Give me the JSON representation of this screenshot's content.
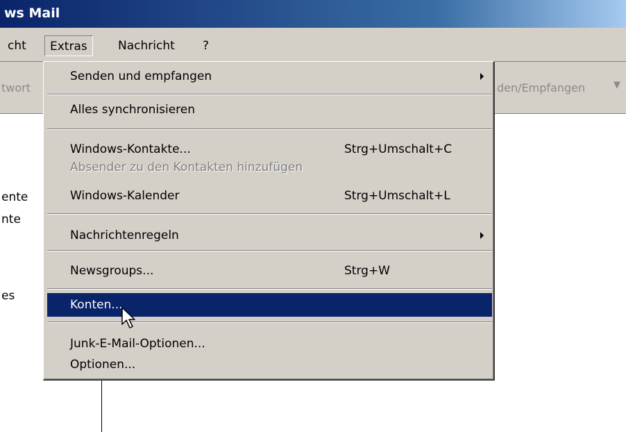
{
  "window": {
    "title": "ws Mail"
  },
  "menubar": {
    "items": [
      "cht",
      "Extras",
      "Nachricht",
      "?"
    ]
  },
  "toolbar": {
    "left_fragment": "twort",
    "right_fragment": "den/Empfangen"
  },
  "left_panel": {
    "fragments": [
      "ente",
      "nte",
      "es"
    ]
  },
  "extras_menu": {
    "items": [
      {
        "label": "Senden und empfangen",
        "shortcut": "",
        "submenu": true,
        "enabled": true
      },
      {
        "label": "Alles synchronisieren",
        "shortcut": "",
        "submenu": false,
        "enabled": true
      },
      {
        "label": "Windows-Kontakte...",
        "shortcut": "Strg+Umschalt+C",
        "submenu": false,
        "enabled": true
      },
      {
        "label": "Absender zu den Kontakten hinzufügen",
        "shortcut": "",
        "submenu": false,
        "enabled": false
      },
      {
        "label": "Windows-Kalender",
        "shortcut": "Strg+Umschalt+L",
        "submenu": false,
        "enabled": true
      },
      {
        "label": "Nachrichtenregeln",
        "shortcut": "",
        "submenu": true,
        "enabled": true
      },
      {
        "label": "Newsgroups...",
        "shortcut": "Strg+W",
        "submenu": false,
        "enabled": true
      },
      {
        "label": "Konten...",
        "shortcut": "",
        "submenu": false,
        "enabled": true,
        "selected": true
      },
      {
        "label": "Junk-E-Mail-Optionen...",
        "shortcut": "",
        "submenu": false,
        "enabled": true
      },
      {
        "label": "Optionen...",
        "shortcut": "",
        "submenu": false,
        "enabled": true
      }
    ]
  },
  "colors": {
    "selection": "#0a246a",
    "menu_bg": "#d4d0c8",
    "disabled_text": "#808080"
  },
  "icons": {
    "cursor": "mouse-pointer-icon",
    "submenu": "submenu-arrow-icon",
    "dropdown": "dropdown-arrow-icon"
  }
}
